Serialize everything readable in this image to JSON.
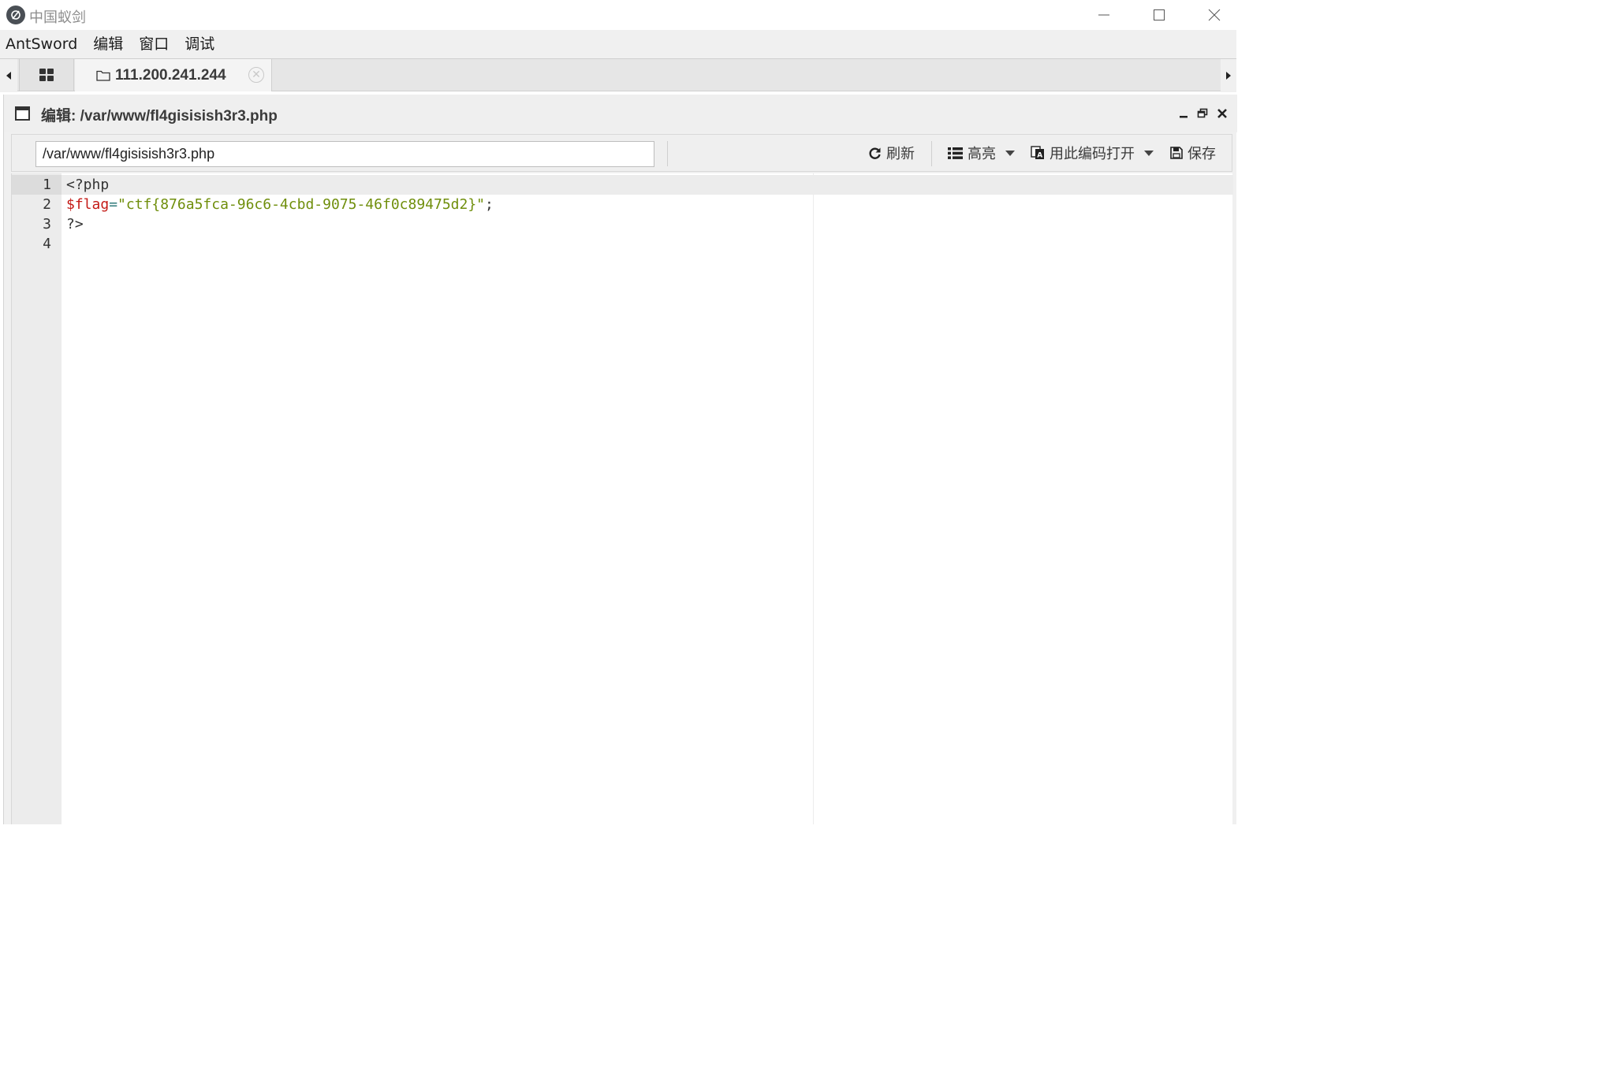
{
  "window": {
    "title": "中国蚁剑"
  },
  "menu": {
    "items": [
      "AntSword",
      "编辑",
      "窗口",
      "调试"
    ]
  },
  "tabs": {
    "active_label": "111.200.241.244"
  },
  "editor_window": {
    "title": "编辑: /var/www/fl4gisisish3r3.php"
  },
  "toolbar": {
    "path_value": "/var/www/fl4gisisish3r3.php",
    "refresh_label": "刷新",
    "highlight_label": "高亮",
    "encoding_label": "用此编码打开",
    "save_label": "保存"
  },
  "code": {
    "line_numbers": [
      "1",
      "2",
      "3",
      "4"
    ],
    "line1": "<?php",
    "line2_var": "$flag",
    "line2_op": "=",
    "line2_str": "\"ctf{876a5fca-96c6-4cbd-9075-46f0c89475d2}\"",
    "line2_end": ";",
    "line3": "?>",
    "line4": ""
  },
  "colors": {
    "variable": "#c41a16",
    "string": "#6f8e0b",
    "operator": "#2f7a7a"
  }
}
